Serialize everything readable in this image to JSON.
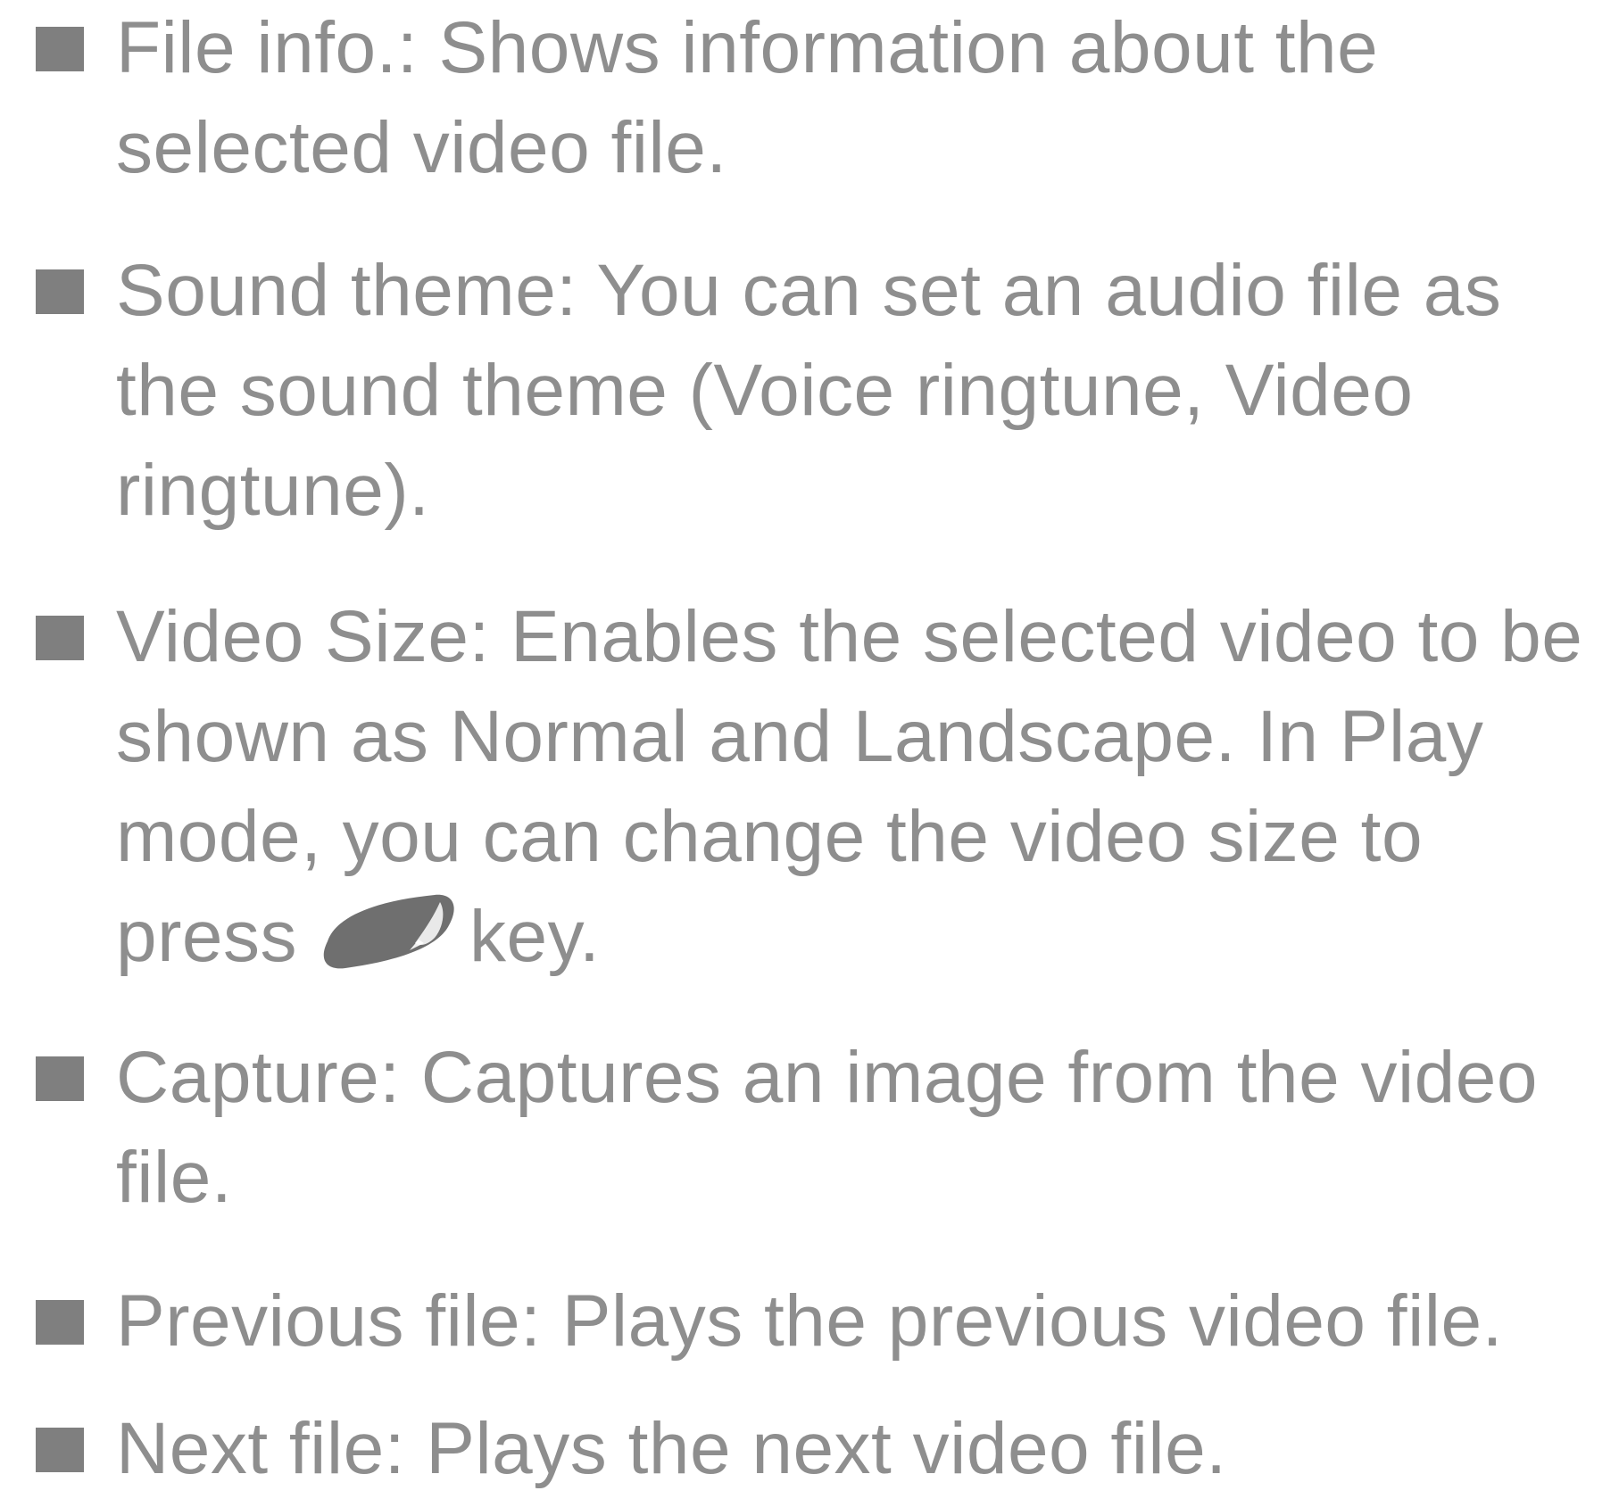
{
  "items": [
    {
      "lines": [
        "File info.: Shows information about the",
        "selected video file."
      ]
    },
    {
      "lines": [
        "Sound theme: You can set an audio file as",
        "the sound theme (Voice ringtune, Video",
        "ringtune)."
      ]
    },
    {
      "lines": [
        "Video Size: Enables the selected video to be",
        "shown as Normal and Landscape. In Play",
        "mode, you can change the video size to"
      ],
      "last_line_before": "press",
      "last_line_icon": "soft-key-icon",
      "last_line_after": "key."
    },
    {
      "lines": [
        "Capture: Captures an image from the video",
        "file."
      ]
    },
    {
      "lines": [
        "Previous file: Plays the previous video file."
      ]
    },
    {
      "lines": [
        "Next file: Plays the next video file."
      ]
    }
  ],
  "colors": {
    "text": "#8e8e8e",
    "bullet": "#7f7f7f",
    "key_icon": "#6f6f6f"
  }
}
